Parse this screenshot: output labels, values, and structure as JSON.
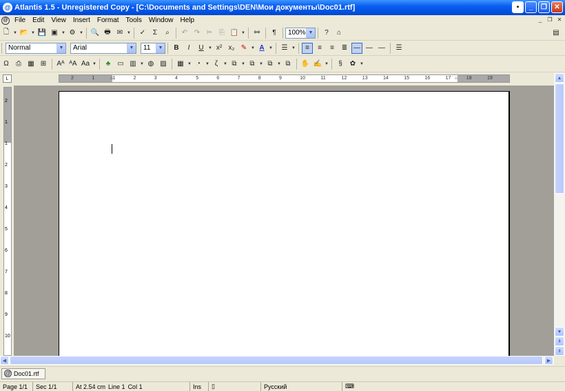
{
  "window": {
    "title": "Atlantis 1.5 - Unregistered Copy - [C:\\Documents and Settings\\DEN\\Мои документы\\Doc01.rtf]"
  },
  "menu": [
    "File",
    "Edit",
    "View",
    "Insert",
    "Format",
    "Tools",
    "Window",
    "Help"
  ],
  "toolbar": {
    "zoom": "100%"
  },
  "format": {
    "style": "Normal",
    "font": "Arial",
    "size": "11"
  },
  "ruler": {
    "h_labels": [
      "2",
      "1",
      "1",
      "2",
      "3",
      "4",
      "5",
      "6",
      "7",
      "8",
      "9",
      "10",
      "11",
      "12",
      "13",
      "14",
      "15",
      "16",
      "17",
      "18",
      "19"
    ],
    "v_labels": [
      "2",
      "1",
      "1",
      "2",
      "3",
      "4",
      "5",
      "6",
      "7",
      "8",
      "9",
      "10"
    ]
  },
  "tabs": [
    {
      "label": "Doc01.rtf"
    }
  ],
  "status": {
    "page": "Page 1/1",
    "section": "Sec 1/1",
    "position": "At 2.54 cm",
    "line": "Line 1",
    "col": "Col 1",
    "mode": "Ins",
    "language": "Русский"
  },
  "colors": {
    "title_bar": "#0a5ff0",
    "workspace": "#a19f98",
    "chrome": "#ece9d8"
  }
}
